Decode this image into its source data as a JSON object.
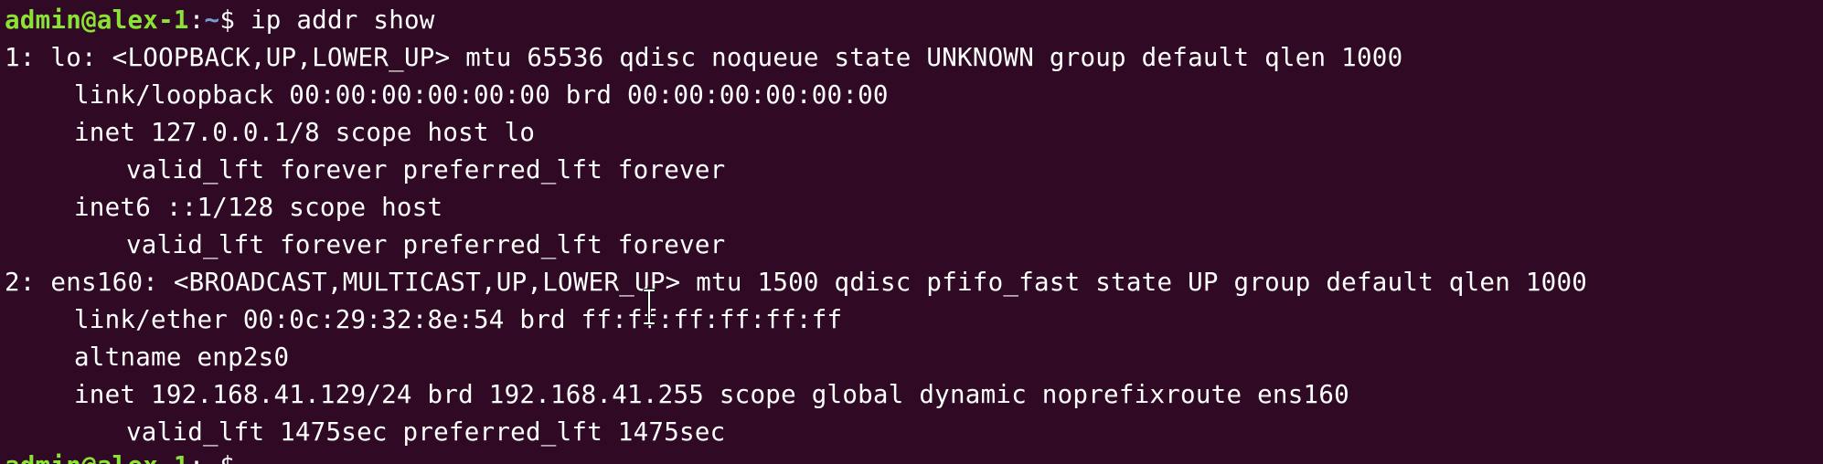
{
  "prompt": {
    "user_host": "admin@alex-1",
    "colon": ":",
    "path": "~",
    "symbol": "$ "
  },
  "command": "ip addr show",
  "output_lines": [
    "1: lo: <LOOPBACK,UP,LOWER_UP> mtu 65536 qdisc noqueue state UNKNOWN group default qlen 1000",
    "link/loopback 00:00:00:00:00:00 brd 00:00:00:00:00:00",
    "inet 127.0.0.1/8 scope host lo",
    "valid_lft forever preferred_lft forever",
    "inet6 ::1/128 scope host",
    "valid_lft forever preferred_lft forever",
    "2: ens160: <BROADCAST,MULTICAST,UP,LOWER_UP> mtu 1500 qdisc pfifo_fast state UP group default qlen 1000",
    "link/ether 00:0c:29:32:8e:54 brd ff:ff:ff:ff:ff:ff",
    "altname enp2s0",
    "inet 192.168.41.129/24 brd 192.168.41.255 scope global dynamic noprefixroute ens160",
    "valid_lft 1475sec preferred_lft 1475sec"
  ],
  "colors": {
    "background": "#300a24",
    "text": "#ffffff",
    "prompt_user": "#8ae234",
    "prompt_path": "#729fcf"
  },
  "icons": {
    "cursor": "text-ibeam-cursor-icon"
  }
}
